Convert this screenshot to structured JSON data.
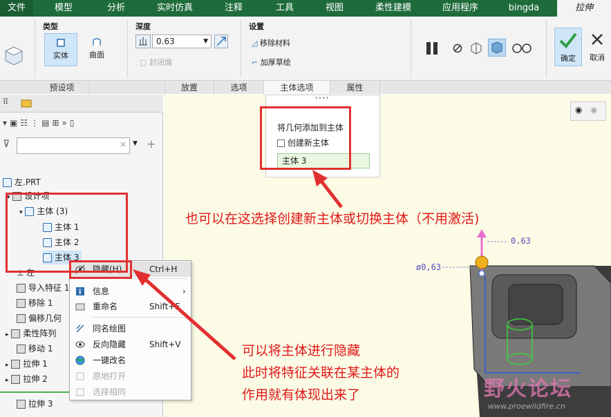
{
  "menubar": {
    "tabs": [
      "文件",
      "模型",
      "分析",
      "实时仿真",
      "注释",
      "工具",
      "视图",
      "柔性建模",
      "应用程序",
      "bingda",
      "拉伸"
    ]
  },
  "ribbon": {
    "type_group": {
      "label": "类型",
      "solid": "实体",
      "surface": "曲面"
    },
    "depth_group": {
      "label": "深度",
      "value": "0.63",
      "closed_ends": "封闭端"
    },
    "settings_group": {
      "label": "设置",
      "remove_material": "移除材料",
      "thicken_sketch": "加厚草绘"
    },
    "ok": "确定",
    "cancel": "取消",
    "subtabs": [
      "预设项",
      "放置",
      "选项",
      "主体选项",
      "属性"
    ]
  },
  "body_options_panel": {
    "title": "将几何添加到主体",
    "create_new_body": "创建新主体",
    "selected_body": "主体 3",
    "grip": "••••"
  },
  "tree": {
    "part": "左.PRT",
    "design_items": "设计项",
    "bodies": "主体 (3)",
    "body1": "主体 1",
    "body2": "主体 2",
    "body3": "主体 3",
    "left": "左",
    "import": "导入特征 1",
    "move": "移除 1",
    "offset": "偏移几何",
    "flex": "柔性阵列",
    "move2": "移动 1",
    "extrude1": "拉伸 1",
    "extrude2": "拉伸 2",
    "extrude3": "拉伸 3"
  },
  "context_menu": {
    "items": [
      {
        "label": "隐藏(H)",
        "shortcut": "Ctrl+H"
      },
      {
        "label": "信息",
        "shortcut": ""
      },
      {
        "label": "重命名",
        "shortcut": "Shift+F"
      },
      {
        "label": "同名绘图",
        "shortcut": ""
      },
      {
        "label": "反向隐藏",
        "shortcut": "Shift+V"
      },
      {
        "label": "一键改名",
        "shortcut": ""
      },
      {
        "label": "原地打开",
        "shortcut": ""
      },
      {
        "label": "选择相同",
        "shortcut": ""
      }
    ]
  },
  "annotations": {
    "top": "也可以在这选择创建新主体或切换主体（不用激活)",
    "bottom1": "可以将主体进行隐藏",
    "bottom2": "此时将特征关联在某主体的",
    "bottom3": "作用就有体现出来了"
  },
  "model": {
    "height_dim": "0.63",
    "dia_dim": "ø0,63"
  },
  "watermark": {
    "cn": "野火论坛",
    "url": "www.proewildfire.cn"
  },
  "colors": {
    "accent": "#1e6c3b",
    "annotation": "#e01818",
    "ok_green": "#2ea043"
  }
}
